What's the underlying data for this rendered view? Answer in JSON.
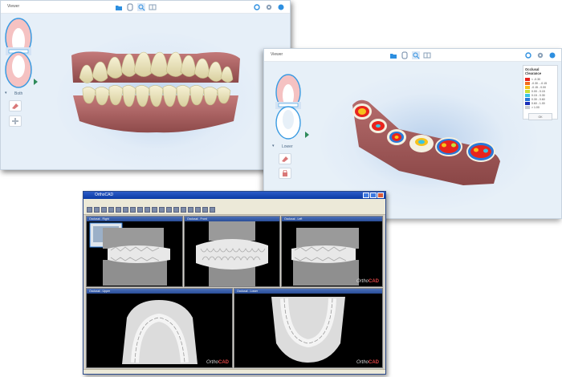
{
  "window1": {
    "title": "Viewer",
    "arch_label": "Both"
  },
  "window2": {
    "title": "Viewer",
    "arch_label": "Lower",
    "legend": {
      "title": "Occlusal Clearance",
      "rows": [
        {
          "color": "#e8241d",
          "label": "< -0.30"
        },
        {
          "color": "#f26b1a",
          "label": "-0.30 - -0.15"
        },
        {
          "color": "#f6c21b",
          "label": "-0.15 - 0.00"
        },
        {
          "color": "#c8e03a",
          "label": "0.00 - 0.15"
        },
        {
          "color": "#39c4e4",
          "label": "0.15 - 0.30"
        },
        {
          "color": "#2a78d8",
          "label": "0.30 - 0.60"
        },
        {
          "color": "#1a2fb8",
          "label": "0.60 - 1.00"
        },
        {
          "color": "#c9ccd2",
          "label": "> 1.00"
        }
      ],
      "button_label": "OK"
    }
  },
  "window3": {
    "title": "OrthoCAD",
    "panes": [
      {
        "title": "Occlusal - Right"
      },
      {
        "title": "Occlusal - Front"
      },
      {
        "title": "Occlusal - Left"
      },
      {
        "title": "Occlusal - Upper"
      },
      {
        "title": "Occlusal - Lower"
      }
    ],
    "logo_prefix": "Ortho",
    "logo_suffix": "CAD"
  },
  "colors": {
    "accent": "#2d8fe0",
    "gum": "#b86a6a",
    "tooth": "#f2edcf"
  }
}
